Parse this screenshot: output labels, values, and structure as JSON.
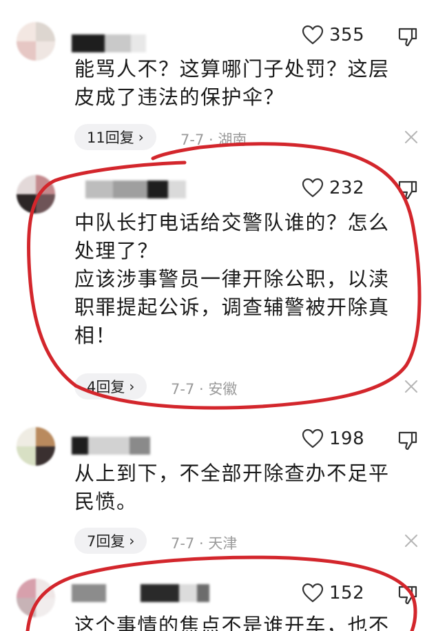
{
  "comments": [
    {
      "likes": "355",
      "text": "能骂人不？这算哪门子处罚？这层\n皮成了违法的保护伞？",
      "reply_label": "11回复",
      "date": "7-7",
      "location": "湖南",
      "meta": "7-7 · 湖南"
    },
    {
      "likes": "232",
      "text": "中队长打电话给交警队谁的？怎么\n处理了？\n应该涉事警员一律开除公职，以渎\n职罪提起公诉，调查辅警被开除真\n相！",
      "reply_label": "4回复",
      "date": "7-7",
      "location": "安徽",
      "meta": "7-7 · 安徽"
    },
    {
      "likes": "198",
      "text": "从上到下，不全部开除查办不足平\n民愤。",
      "reply_label": "7回复",
      "date": "7-7",
      "location": "天津",
      "meta": "7-7 · 天津"
    },
    {
      "likes": "152",
      "text": "这个事情的焦点不是谁开车，也不"
    }
  ],
  "icons": {
    "like": "heart-outline-icon",
    "dislike": "thumbs-down-icon",
    "close": "close-icon",
    "chevron": "chevron-right-icon"
  },
  "colors": {
    "annotation_ring": "#d3262c",
    "reply_pill_bg": "#f1f1f3",
    "meta_text": "#9a9a9a"
  }
}
